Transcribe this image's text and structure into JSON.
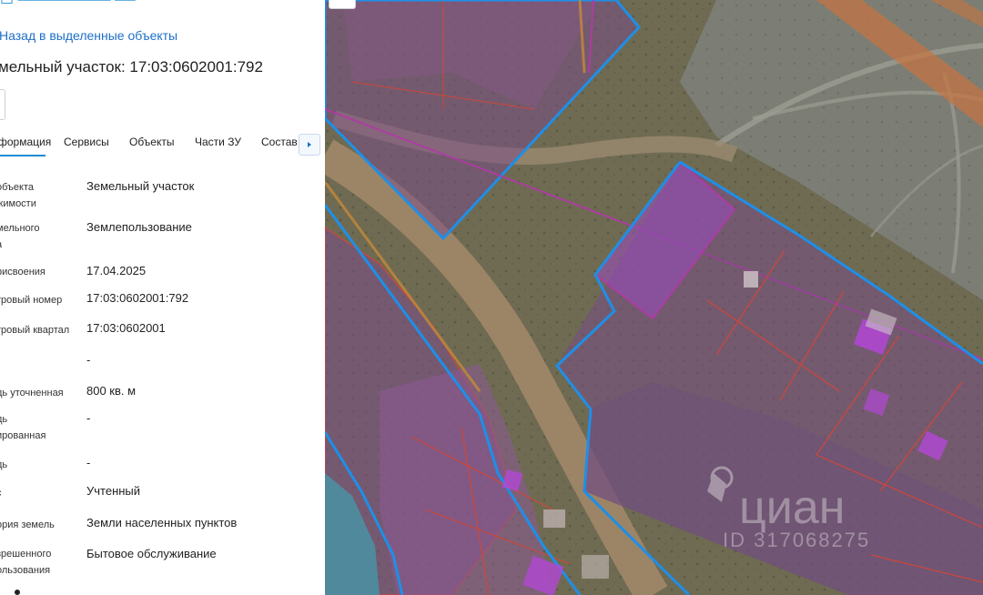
{
  "panel": {
    "back_link": "Назад в выделенные объекты",
    "title": "мельный участок: 17:03:0602001:792",
    "tabs": [
      {
        "label": "формация",
        "active": true
      },
      {
        "label": "Сервисы",
        "active": false
      },
      {
        "label": "Объекты",
        "active": false
      },
      {
        "label": "Части ЗУ",
        "active": false
      },
      {
        "label": "Состав",
        "active": false
      }
    ],
    "rows": [
      {
        "label_lines": [
          "объекта",
          "жимости"
        ],
        "value": "Земельный участок"
      },
      {
        "label_lines": [
          "мельного",
          "а"
        ],
        "value": "Землепользование"
      },
      {
        "label_lines": [
          "рисвоения"
        ],
        "value": "17.04.2025"
      },
      {
        "label_lines": [
          "тровый номер"
        ],
        "value": "17:03:0602001:792"
      },
      {
        "label_lines": [
          "тровый квартал"
        ],
        "value": "17:03:0602001"
      },
      {
        "label_lines": [
          ""
        ],
        "value": "-"
      },
      {
        "label_lines": [
          "дь уточненная"
        ],
        "value": "800 кв. м"
      },
      {
        "label_lines": [
          "дь",
          "ированная"
        ],
        "value": "-"
      },
      {
        "label_lines": [
          "дь"
        ],
        "value": "-"
      },
      {
        "label_lines": [
          "с"
        ],
        "value": "Учтенный"
      },
      {
        "label_lines": [
          "ория земель"
        ],
        "value": "Земли населенных пунктов"
      },
      {
        "label_lines": [
          "зрешенного",
          "ользования"
        ],
        "value": "Бытовое обслуживание"
      }
    ]
  },
  "map": {
    "watermark_brand": "циан",
    "watermark_id": "ID 317068275",
    "colors": {
      "selected_outline": "#1e8fe8",
      "parcel_fill": "#7a4a8a",
      "parcel_outline": "#d0463a",
      "zone_outline": "#b03aa6",
      "building_fill": "#b347d6",
      "road": "#a58a6a",
      "terrain": "#6d6a4f"
    }
  },
  "icons": {
    "tab_next": "chevron-right-icon",
    "watermark_logo": "cian-logo-icon"
  }
}
